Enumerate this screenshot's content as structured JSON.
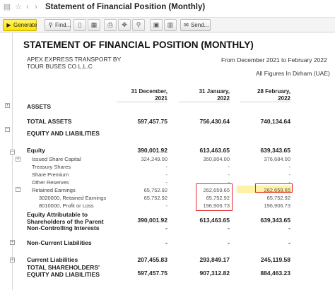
{
  "window": {
    "title": "Statement of Financial Position (Monthly)"
  },
  "toolbar": {
    "generate_label": "Generate",
    "find_label": "Find...",
    "send_label": "Send..."
  },
  "report": {
    "title": "STATEMENT OF FINANCIAL POSITION (MONTHLY)",
    "company_line1": "APEX EXPRESS TRANSPORT BY",
    "company_line2": "TOUR BUSES CO L.L.C",
    "period": "From December 2021 to February 2022",
    "figures_note": "All Figures In Dirham (UAE)",
    "columns": [
      {
        "line1": "31 December,",
        "line2": "2021"
      },
      {
        "line1": "31 January,",
        "line2": "2022"
      },
      {
        "line1": "28 February,",
        "line2": "2022"
      }
    ],
    "rows": [
      {
        "label": "ASSETS",
        "values": [
          "",
          "",
          ""
        ]
      },
      {
        "label": "TOTAL ASSETS",
        "values": [
          "597,457.75",
          "756,430.64",
          "740,134.64"
        ]
      },
      {
        "label": "EQUITY AND LIABILITIES",
        "values": [
          "",
          "",
          ""
        ]
      },
      {
        "label": "Equity",
        "values": [
          "390,001.92",
          "613,463.65",
          "639,343.65"
        ]
      },
      {
        "label": "Issued Share Capital",
        "values": [
          "324,249.00",
          "350,804.00",
          "376,684.00"
        ]
      },
      {
        "label": "Treasury Shares",
        "values": [
          "-",
          "-",
          "-"
        ]
      },
      {
        "label": "Share Premium",
        "values": [
          "-",
          "-",
          "-"
        ]
      },
      {
        "label": "Other Reserves",
        "values": [
          "-",
          "-",
          "-"
        ]
      },
      {
        "label": "Retained Earnings",
        "values": [
          "65,752.92",
          "262,659.65",
          "262,659.65"
        ]
      },
      {
        "label": "3020000, Retained Earnings",
        "values": [
          "65,752.92",
          "65,752.92",
          "65,752.92"
        ]
      },
      {
        "label": "8010000, Profit or Loss",
        "values": [
          "-",
          "196,906.73",
          "196,906.73"
        ]
      },
      {
        "label_line1": "Equity Attributable to",
        "label_line2": "Shareholders of the Parent",
        "values": [
          "390,001.92",
          "613,463.65",
          "639,343.65"
        ]
      },
      {
        "label": "Non-Controlling Interests",
        "values": [
          "-",
          "-",
          "-"
        ]
      },
      {
        "label": "Non-Current Liabilities",
        "values": [
          "-",
          "-",
          "-"
        ]
      },
      {
        "label": "Current Liabilities",
        "values": [
          "207,455.83",
          "293,849.17",
          "245,119.58"
        ]
      },
      {
        "label_line1": "TOTAL SHAREHOLDERS'",
        "label_line2": "EQUITY AND LIABILITIES",
        "values": [
          "597,457.75",
          "907,312.82",
          "884,463.23"
        ]
      }
    ]
  }
}
